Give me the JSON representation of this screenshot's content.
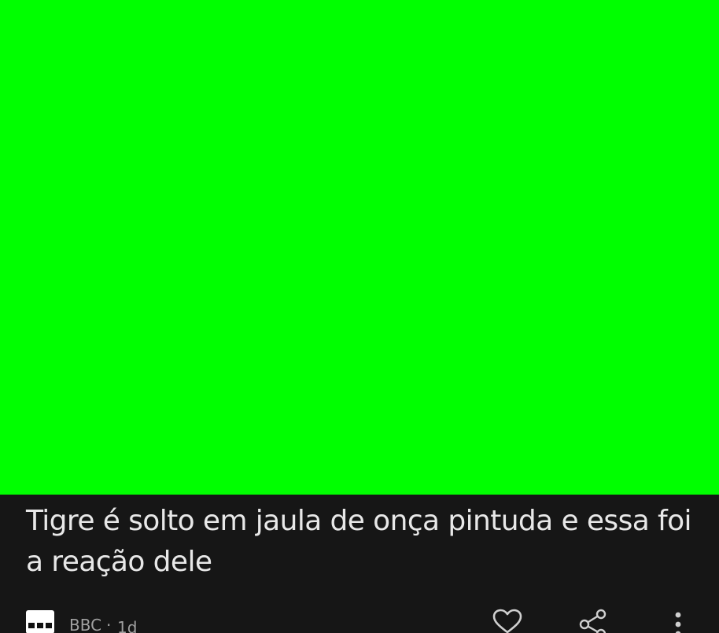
{
  "media": {
    "background_color": "#00ff00"
  },
  "article": {
    "headline_line1": "Tigre é solto em jaula de onça pintuda e essa foi",
    "headline_line2": "a reação dele",
    "source": "BBC",
    "separator": "·",
    "age": "1d"
  },
  "actions": {
    "like_icon": "heart-icon",
    "share_icon": "share-icon",
    "more_icon": "more-vertical-icon"
  },
  "colors": {
    "card_background": "#161616",
    "headline_text": "#e8e8e8",
    "meta_text": "#a0a0a0"
  }
}
